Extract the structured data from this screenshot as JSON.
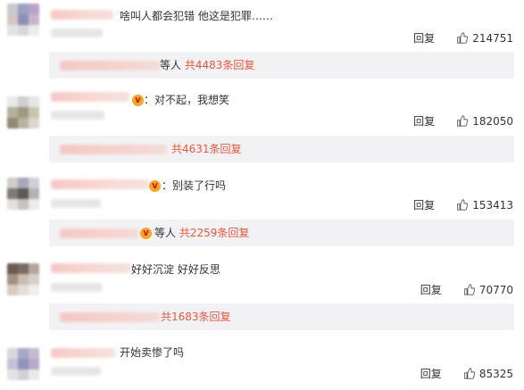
{
  "comments": [
    {
      "text": "啥叫人都会犯错 他这是犯罪……",
      "reply_label": "回复",
      "likes": "214751",
      "reply_summary": {
        "suffix": "等人",
        "count_text": "共4483条回复"
      }
    },
    {
      "text": "：对不起，我想笑",
      "reply_label": "回复",
      "likes": "182050",
      "reply_summary": {
        "suffix": "",
        "count_text": "共4631条回复"
      }
    },
    {
      "text": "：别装了行吗",
      "reply_label": "回复",
      "likes": "153413",
      "reply_summary": {
        "suffix": "等人",
        "count_text": "共2259条回复"
      }
    },
    {
      "text": "好好沉淀 好好反思",
      "reply_label": "回复",
      "likes": "70770",
      "reply_summary": {
        "suffix": "",
        "count_text": "共1683条回复"
      }
    },
    {
      "text": "开始卖惨了吗",
      "reply_label": "回复",
      "likes": "85325"
    }
  ],
  "icons": {
    "like": "thumbs-up-icon",
    "badge": "vip-badge-icon"
  },
  "colors": {
    "reply_count": "#e8573a",
    "reply_box_bg": "#f2f2f5",
    "text": "#333333"
  }
}
